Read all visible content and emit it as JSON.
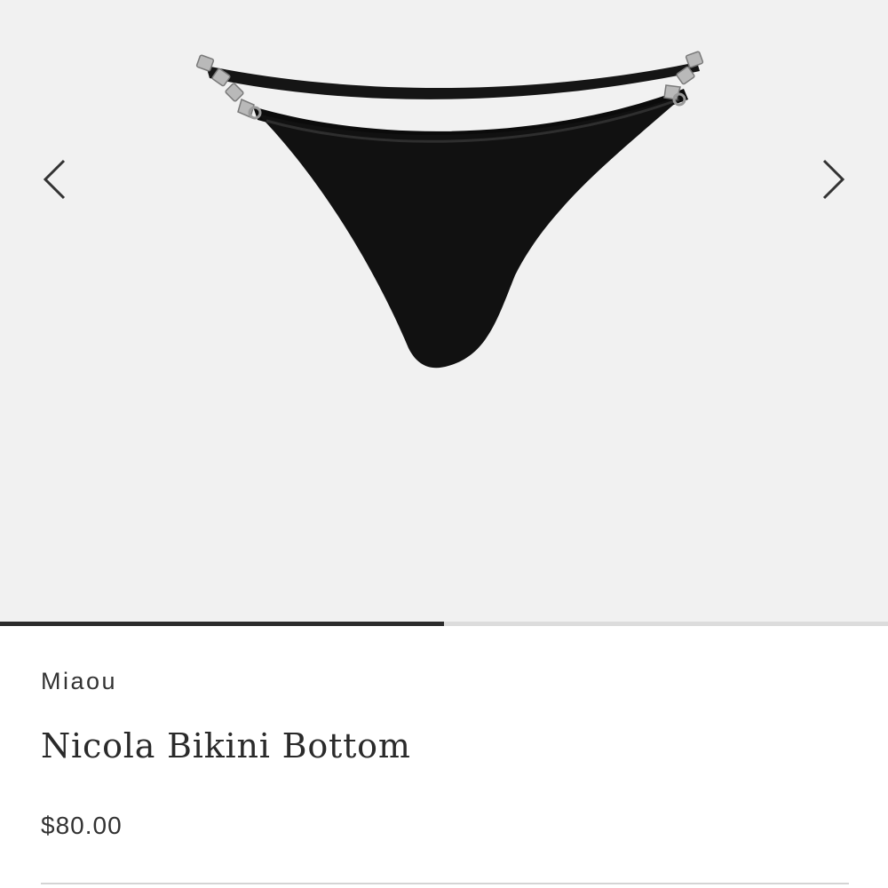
{
  "gallery": {
    "image_alt": "Nicola Bikini Bottom in black",
    "prev_icon": "chevron-left-icon",
    "next_icon": "chevron-right-icon",
    "progress": 0.5,
    "progress_color": "#2b2b2b",
    "track_color": "#dcdcdc",
    "background_color": "#f1f1f1"
  },
  "product": {
    "brand": "Miaou",
    "name": "Nicola Bikini Bottom",
    "price": "$80.00",
    "color": "#111111"
  }
}
